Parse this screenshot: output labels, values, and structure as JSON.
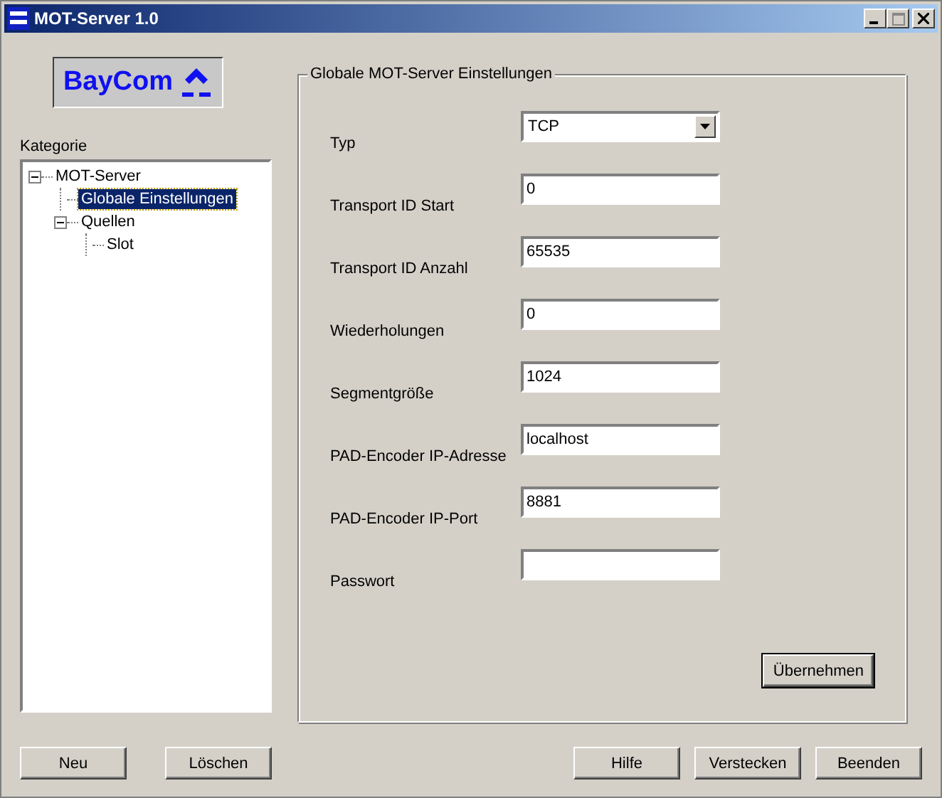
{
  "window": {
    "title": "MOT-Server 1.0"
  },
  "logo": {
    "text": "BayCom"
  },
  "category": {
    "label": "Kategorie",
    "tree": [
      {
        "label": "MOT-Server",
        "expanded": true,
        "selected": false,
        "children": [
          {
            "label": "Globale Einstellungen",
            "selected": true
          },
          {
            "label": "Quellen",
            "expanded": true,
            "selected": false,
            "children": [
              {
                "label": "Slot",
                "selected": false
              }
            ]
          }
        ]
      }
    ]
  },
  "settings": {
    "title": "Globale MOT-Server Einstellungen",
    "fields": [
      {
        "kind": "dropdown",
        "label": "Typ",
        "value": "TCP"
      },
      {
        "kind": "text",
        "label": "Transport ID Start",
        "value": "0"
      },
      {
        "kind": "text",
        "label": "Transport ID Anzahl",
        "value": "65535"
      },
      {
        "kind": "text",
        "label": "Wiederholungen",
        "value": "0"
      },
      {
        "kind": "text",
        "label": "Segmentgröße",
        "value": "1024"
      },
      {
        "kind": "text",
        "label": "PAD-Encoder IP-Adresse",
        "value": "localhost"
      },
      {
        "kind": "text",
        "label": "PAD-Encoder IP-Port",
        "value": "8881"
      },
      {
        "kind": "text",
        "label": "Passwort"
      }
    ],
    "apply_button": "Übernehmen"
  },
  "left_buttons": [
    "Neu",
    "Löschen"
  ],
  "right_buttons": [
    "Hilfe",
    "Verstecken",
    "Beenden"
  ]
}
